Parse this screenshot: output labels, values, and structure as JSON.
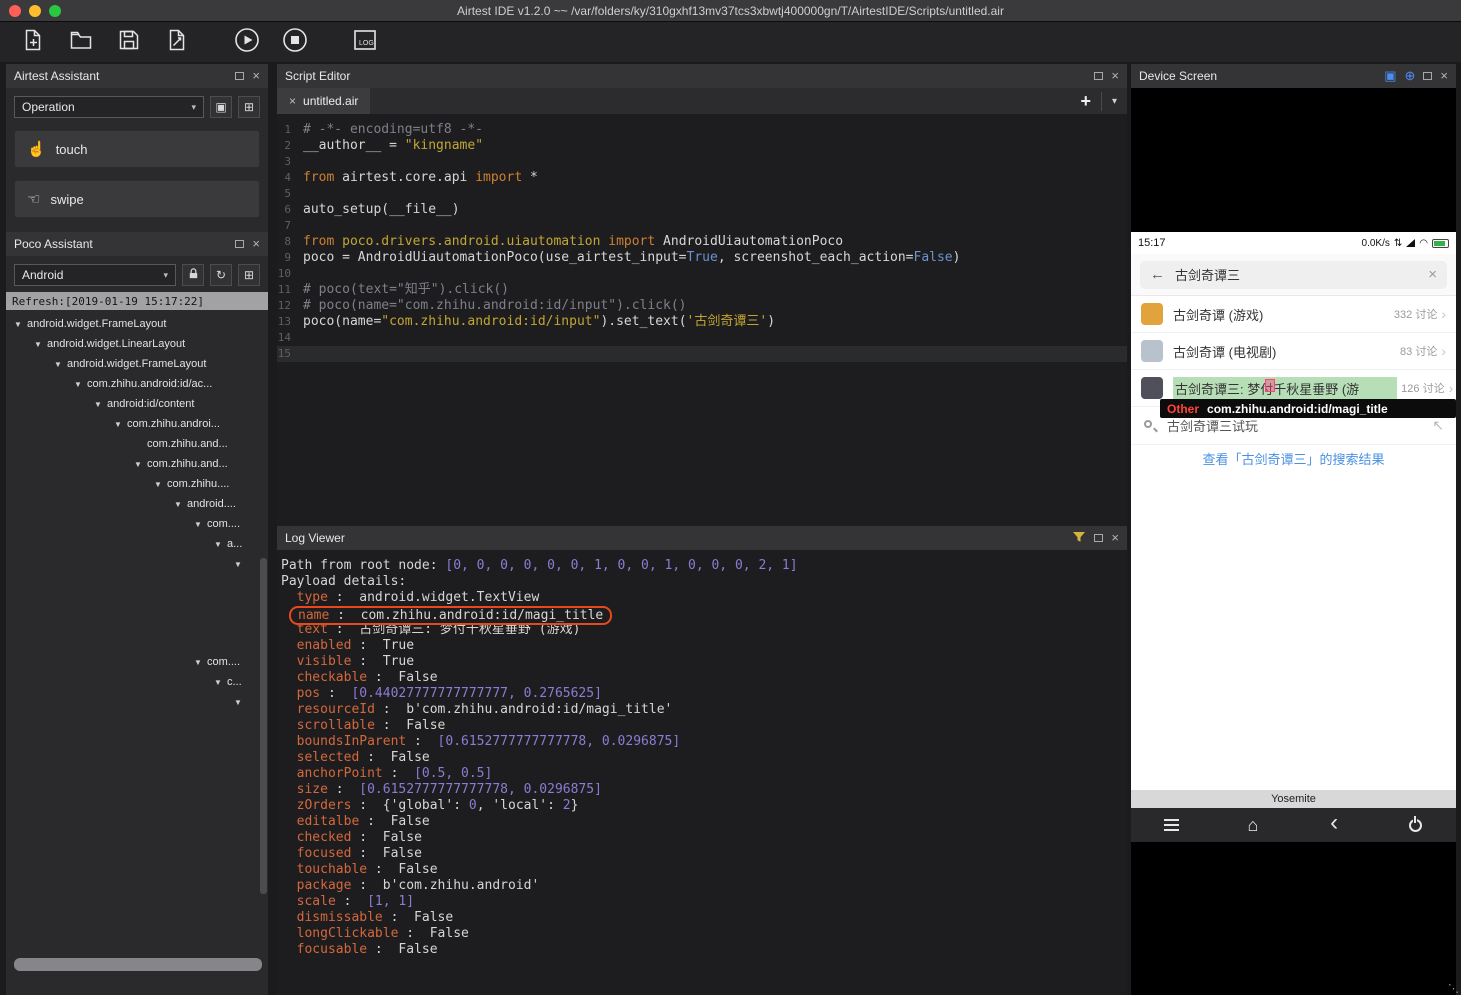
{
  "window": {
    "title": "Airtest IDE v1.2.0 ~~ /var/folders/ky/310gxhf13mv37tcs3xbwtj400000gn/T/AirtestIDE/Scripts/untitled.air"
  },
  "toolbar": {
    "buttons": [
      "new-script",
      "open-script",
      "save-script",
      "save-as-script",
      "run-script",
      "stop-script",
      "toggle-log-window"
    ]
  },
  "airtest_assistant": {
    "title": "Airtest Assistant",
    "mode": "Operation",
    "actions": [
      "touch",
      "swipe"
    ]
  },
  "poco_assistant": {
    "title": "Poco Assistant",
    "driver": "Android",
    "refresh_label": "Refresh:[2019-01-19 15:17:22]",
    "tree": [
      {
        "i": 0,
        "a": true,
        "t": "android.widget.FrameLayout"
      },
      {
        "i": 1,
        "a": true,
        "t": "android.widget.LinearLayout"
      },
      {
        "i": 2,
        "a": true,
        "t": "android.widget.FrameLayout"
      },
      {
        "i": 3,
        "a": true,
        "t": "com.zhihu.android:id/ac..."
      },
      {
        "i": 4,
        "a": true,
        "t": "android:id/content"
      },
      {
        "i": 5,
        "a": true,
        "t": "com.zhihu.androi..."
      },
      {
        "i": 6,
        "a": false,
        "t": "com.zhihu.and..."
      },
      {
        "i": 6,
        "a": true,
        "t": "com.zhihu.and..."
      },
      {
        "i": 7,
        "a": true,
        "t": "com.zhihu...."
      },
      {
        "i": 8,
        "a": true,
        "t": "android...."
      },
      {
        "i": 9,
        "a": true,
        "t": "com...."
      },
      {
        "i": 10,
        "a": true,
        "t": "a..."
      },
      {
        "i": 11,
        "a": true,
        "t": ""
      },
      {
        "spacer": 78
      },
      {
        "i": 9,
        "a": true,
        "t": "com...."
      },
      {
        "i": 10,
        "a": true,
        "t": "c..."
      },
      {
        "i": 11,
        "a": true,
        "t": ""
      }
    ]
  },
  "script_editor": {
    "title": "Script Editor",
    "tab": "untitled.air",
    "lines": [
      {
        "segs": [
          [
            "cm",
            "# -*- encoding=utf8 -*-"
          ]
        ]
      },
      {
        "segs": [
          [
            "w",
            "__author__ = "
          ],
          [
            "s",
            "\"kingname\""
          ]
        ]
      },
      {
        "segs": []
      },
      {
        "segs": [
          [
            "kw",
            "from "
          ],
          [
            "w",
            "airtest.core.api "
          ],
          [
            "kw",
            "import "
          ],
          [
            "w",
            "*"
          ]
        ]
      },
      {
        "segs": []
      },
      {
        "segs": [
          [
            "w",
            "auto_setup(__file__)"
          ]
        ]
      },
      {
        "segs": []
      },
      {
        "segs": [
          [
            "kw",
            "from "
          ],
          [
            "s",
            "poco.drivers.android.uiautomation "
          ],
          [
            "kw",
            "import "
          ],
          [
            "w",
            "AndroidUiautomationPoco"
          ]
        ]
      },
      {
        "segs": [
          [
            "w",
            "poco = AndroidUiautomationPoco(use_airtest_input="
          ],
          [
            "b",
            "True"
          ],
          [
            "w",
            ", screenshot_each_action="
          ],
          [
            "b",
            "False"
          ],
          [
            "w",
            ")"
          ]
        ]
      },
      {
        "segs": []
      },
      {
        "segs": [
          [
            "cm",
            "# poco(text=\"知乎\").click()"
          ]
        ]
      },
      {
        "segs": [
          [
            "cm",
            "# poco(name=\"com.zhihu.android:id/input\").click()"
          ]
        ]
      },
      {
        "segs": [
          [
            "w",
            "poco(name="
          ],
          [
            "s",
            "\"com.zhihu.android:id/input\""
          ],
          [
            "w",
            ").set_text("
          ],
          [
            "s",
            "'古剑奇谭三'"
          ],
          [
            "w",
            ")"
          ]
        ]
      },
      {
        "segs": []
      },
      {
        "segs": [],
        "current": true
      }
    ]
  },
  "log_viewer": {
    "title": "Log Viewer",
    "lines": [
      {
        "segs": [
          [
            "w",
            "Path from root node: "
          ],
          [
            "n",
            "[0, 0, 0, 0, 0, 0, 1, 0, 0, 1, 0, 0, 0, 2, 1]"
          ]
        ]
      },
      {
        "segs": [
          [
            "w",
            "Payload details:"
          ]
        ]
      },
      {
        "segs": [
          [
            "w",
            "  "
          ],
          [
            "k",
            "type"
          ],
          [
            "w",
            " :  android.widget.TextView"
          ]
        ]
      },
      {
        "boxed": true,
        "segs": [
          [
            "k",
            "name"
          ],
          [
            "w",
            " :  com.zhihu.android:id/magi_title"
          ]
        ]
      },
      {
        "segs": [
          [
            "w",
            "  "
          ],
          [
            "k",
            "text"
          ],
          [
            "w",
            " :  古剑奇谭三: 梦付千秋星垂野 (游戏)"
          ]
        ]
      },
      {
        "segs": [
          [
            "w",
            "  "
          ],
          [
            "k",
            "enabled"
          ],
          [
            "w",
            " :  True"
          ]
        ]
      },
      {
        "segs": [
          [
            "w",
            "  "
          ],
          [
            "k",
            "visible"
          ],
          [
            "w",
            " :  True"
          ]
        ]
      },
      {
        "segs": [
          [
            "w",
            "  "
          ],
          [
            "k",
            "checkable"
          ],
          [
            "w",
            " :  False"
          ]
        ]
      },
      {
        "segs": [
          [
            "w",
            "  "
          ],
          [
            "k",
            "pos"
          ],
          [
            "w",
            " :  "
          ],
          [
            "n",
            "[0.44027777777777777, 0.2765625]"
          ]
        ]
      },
      {
        "segs": [
          [
            "w",
            "  "
          ],
          [
            "k",
            "resourceId"
          ],
          [
            "w",
            " :  b'com.zhihu.android:id/magi_title'"
          ]
        ]
      },
      {
        "segs": [
          [
            "w",
            "  "
          ],
          [
            "k",
            "scrollable"
          ],
          [
            "w",
            " :  False"
          ]
        ]
      },
      {
        "segs": [
          [
            "w",
            "  "
          ],
          [
            "k",
            "boundsInParent"
          ],
          [
            "w",
            " :  "
          ],
          [
            "n",
            "[0.6152777777777778, 0.0296875]"
          ]
        ]
      },
      {
        "segs": [
          [
            "w",
            "  "
          ],
          [
            "k",
            "selected"
          ],
          [
            "w",
            " :  False"
          ]
        ]
      },
      {
        "segs": [
          [
            "w",
            "  "
          ],
          [
            "k",
            "anchorPoint"
          ],
          [
            "w",
            " :  "
          ],
          [
            "n",
            "[0.5, 0.5]"
          ]
        ]
      },
      {
        "segs": [
          [
            "w",
            "  "
          ],
          [
            "k",
            "size"
          ],
          [
            "w",
            " :  "
          ],
          [
            "n",
            "[0.6152777777777778, 0.0296875]"
          ]
        ]
      },
      {
        "segs": [
          [
            "w",
            "  "
          ],
          [
            "k",
            "zOrders"
          ],
          [
            "w",
            " :  {'global': "
          ],
          [
            "n",
            "0"
          ],
          [
            "w",
            ", 'local': "
          ],
          [
            "n",
            "2"
          ],
          [
            "w",
            "}"
          ]
        ]
      },
      {
        "segs": [
          [
            "w",
            "  "
          ],
          [
            "k",
            "editalbe"
          ],
          [
            "w",
            " :  False"
          ]
        ]
      },
      {
        "segs": [
          [
            "w",
            "  "
          ],
          [
            "k",
            "checked"
          ],
          [
            "w",
            " :  False"
          ]
        ]
      },
      {
        "segs": [
          [
            "w",
            "  "
          ],
          [
            "k",
            "focused"
          ],
          [
            "w",
            " :  False"
          ]
        ]
      },
      {
        "segs": [
          [
            "w",
            "  "
          ],
          [
            "k",
            "touchable"
          ],
          [
            "w",
            " :  False"
          ]
        ]
      },
      {
        "segs": [
          [
            "w",
            "  "
          ],
          [
            "k",
            "package"
          ],
          [
            "w",
            " :  b'com.zhihu.android'"
          ]
        ]
      },
      {
        "segs": [
          [
            "w",
            "  "
          ],
          [
            "k",
            "scale"
          ],
          [
            "w",
            " :  "
          ],
          [
            "n",
            "[1, 1]"
          ]
        ]
      },
      {
        "segs": [
          [
            "w",
            "  "
          ],
          [
            "k",
            "dismissable"
          ],
          [
            "w",
            " :  False"
          ]
        ]
      },
      {
        "segs": [
          [
            "w",
            "  "
          ],
          [
            "k",
            "longClickable"
          ],
          [
            "w",
            " :  False"
          ]
        ]
      },
      {
        "segs": [
          [
            "w",
            "  "
          ],
          [
            "k",
            "focusable"
          ],
          [
            "w",
            " :  False"
          ]
        ]
      }
    ]
  },
  "device_screen": {
    "title": "Device Screen",
    "device_name": "Yosemite",
    "status": {
      "time": "15:17",
      "net_speed": "0.0K/s"
    },
    "search": {
      "value": "古剑奇谭三"
    },
    "results": [
      {
        "title": "古剑奇谭 (游戏)",
        "count": "332 讨论",
        "icon_color": "#e2a23c",
        "highlighted": false
      },
      {
        "title": "古剑奇谭 (电视剧)",
        "count": "83 讨论",
        "icon_color": "#b8c2cc",
        "highlighted": false
      },
      {
        "title": "古剑奇谭三: 梦付千秋星垂野 (游",
        "count": "126 讨论",
        "icon_color": "#50505a",
        "highlighted": true
      }
    ],
    "tooltip": {
      "tag": "Other",
      "value": "com.zhihu.android:id/magi_title"
    },
    "suggestion": "古剑奇谭三试玩",
    "see_all_link": "查看「古剑奇谭三」的搜索结果"
  },
  "colors": {
    "highlight_box": "#e8481c",
    "tooltip_tag": "#ff4538",
    "link_blue": "#4a90e2",
    "selection_green": "#7bc47b",
    "keyword": "#cc8033",
    "string": "#c2a633",
    "comment": "#7f7f8a",
    "bool": "#6a93cf",
    "log_key": "#d4683c",
    "log_number": "#8d7bd4"
  }
}
